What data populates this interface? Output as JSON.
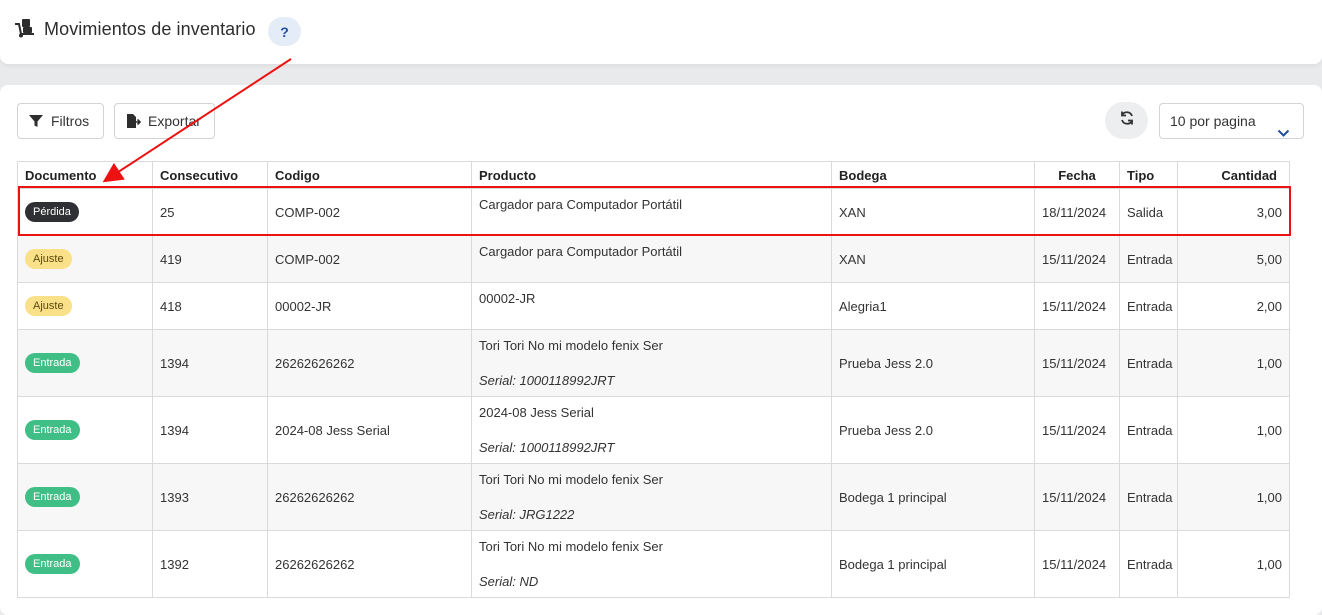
{
  "header": {
    "title": "Movimientos de inventario",
    "help_label": "?",
    "icon": "truck-dolly-icon"
  },
  "toolbar": {
    "filters_label": "Filtros",
    "export_label": "Exportar",
    "per_page_label": "10 por pagina",
    "refresh_icon": "refresh-icon"
  },
  "table": {
    "columns": [
      "Documento",
      "Consecutivo",
      "Codigo",
      "Producto",
      "Bodega",
      "Fecha",
      "Tipo",
      "Cantidad"
    ],
    "rows": [
      {
        "documento": "Pérdida",
        "consecutivo": "25",
        "codigo": "COMP-002",
        "producto": "Cargador para Computador Portátil",
        "serial": "",
        "bodega": "XAN",
        "fecha": "18/11/2024",
        "tipo": "Salida",
        "cantidad": "3,00"
      },
      {
        "documento": "Ajuste",
        "consecutivo": "419",
        "codigo": "COMP-002",
        "producto": "Cargador para Computador Portátil",
        "serial": "",
        "bodega": "XAN",
        "fecha": "15/11/2024",
        "tipo": "Entrada",
        "cantidad": "5,00"
      },
      {
        "documento": "Ajuste",
        "consecutivo": "418",
        "codigo": "00002-JR",
        "producto": "00002-JR",
        "serial": "",
        "bodega": "Alegria1",
        "fecha": "15/11/2024",
        "tipo": "Entrada",
        "cantidad": "2,00"
      },
      {
        "documento": "Entrada",
        "consecutivo": "1394",
        "codigo": "26262626262",
        "producto": "Tori Tori No mi modelo fenix Ser",
        "serial": "Serial: 1000118992JRT",
        "bodega": "Prueba Jess 2.0",
        "fecha": "15/11/2024",
        "tipo": "Entrada",
        "cantidad": "1,00"
      },
      {
        "documento": "Entrada",
        "consecutivo": "1394",
        "codigo": "2024-08 Jess Serial",
        "producto": "2024-08 Jess Serial",
        "serial": "Serial: 1000118992JRT",
        "bodega": "Prueba Jess 2.0",
        "fecha": "15/11/2024",
        "tipo": "Entrada",
        "cantidad": "1,00"
      },
      {
        "documento": "Entrada",
        "consecutivo": "1393",
        "codigo": "26262626262",
        "producto": "Tori Tori No mi modelo fenix Ser",
        "serial": "Serial: JRG1222",
        "bodega": "Bodega 1 principal",
        "fecha": "15/11/2024",
        "tipo": "Entrada",
        "cantidad": "1,00"
      },
      {
        "documento": "Entrada",
        "consecutivo": "1392",
        "codigo": "26262626262",
        "producto": "Tori Tori No mi modelo fenix Ser",
        "serial": "Serial: ND",
        "bodega": "Bodega 1 principal",
        "fecha": "15/11/2024",
        "tipo": "Entrada",
        "cantidad": "1,00"
      }
    ]
  },
  "annotation": {
    "highlight_color": "#ee1111"
  },
  "colors": {
    "badge_perdida": "#2f3033",
    "badge_ajuste": "#fbe08a",
    "badge_entrada": "#3fbf86",
    "accent": "#1f4f9c"
  }
}
